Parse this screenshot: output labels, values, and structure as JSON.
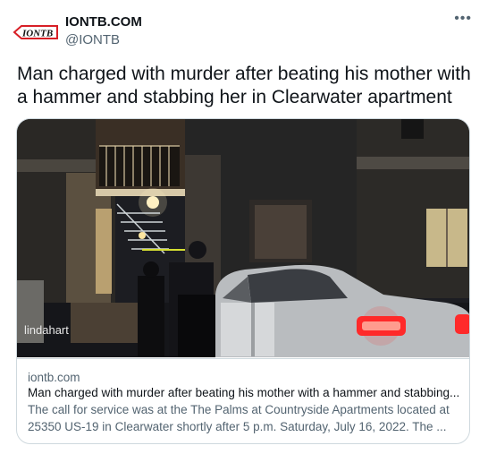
{
  "author": {
    "name": "IONTB.COM",
    "handle": "@IONTB",
    "logo_text": "IONTB"
  },
  "tweet": {
    "text": "Man charged with murder after beating his mother with a hammer and stabbing her in Clearwater apartment"
  },
  "card": {
    "watermark": "lindahart",
    "domain": "iontb.com",
    "title": "Man charged with murder after beating his mother with a hammer and stabbing...",
    "description": "The call for service was at the The Palms at Countryside Apartments located at 25350 US-19 in Clearwater shortly after 5 p.m. Saturday, July 16, 2022. The ..."
  },
  "icons": {
    "more": "more-dots-icon"
  },
  "colors": {
    "text": "#0f1419",
    "secondary": "#536471",
    "border": "#cfd9de",
    "logo_red": "#d81f26",
    "taillight": "#ff2a2a"
  }
}
